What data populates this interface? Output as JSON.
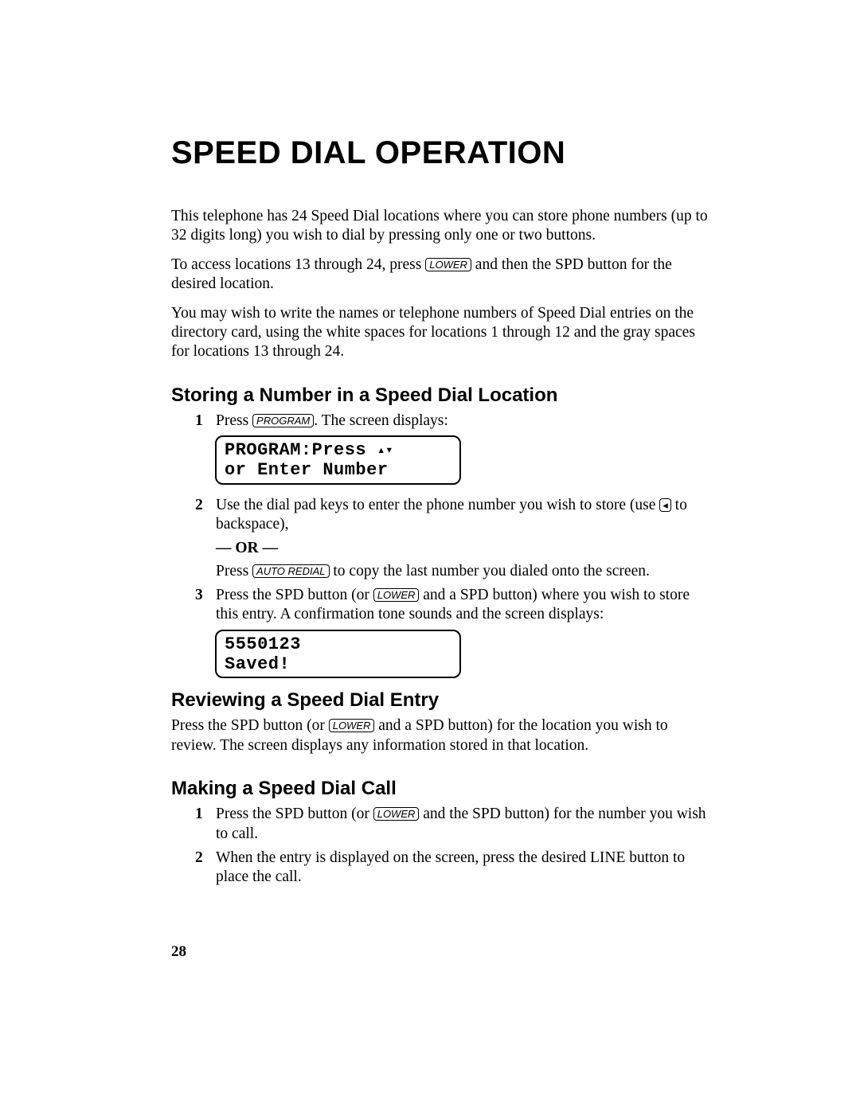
{
  "title": "SPEED DIAL OPERATION",
  "intro": {
    "p1": "This telephone has 24 Speed Dial locations where you can store phone numbers (up to 32 digits long) you wish to dial by pressing only one or two buttons.",
    "p2a": "To access locations 13 through 24, press ",
    "p2_key": "LOWER",
    "p2b": " and then the SPD button for the desired location.",
    "p3": "You may wish to write the names or telephone numbers of Speed Dial entries on the directory card, using the white spaces for locations 1 through 12 and the gray spaces for locations 13 through 24."
  },
  "storing": {
    "heading": "Storing a Number in a Speed Dial Location",
    "step1_num": "1",
    "step1a": "Press ",
    "step1_key": "PROGRAM",
    "step1b": ". The screen displays:",
    "lcd1_line1a": "PROGRAM:Press ",
    "lcd1_line1_arrows": "▴▾",
    "lcd1_line2": "or Enter Number",
    "step2_num": "2",
    "step2a": "Use the dial pad keys to enter the phone number you wish to store (use ",
    "step2_key": "◂",
    "step2b": " to backspace),",
    "or": "— OR —",
    "step2c_a": "Press ",
    "step2c_key": "AUTO REDIAL",
    "step2c_b": " to copy the last number you dialed onto the screen.",
    "step3_num": "3",
    "step3a": "Press the SPD button (or ",
    "step3_key": "LOWER",
    "step3b": " and a SPD button) where you wish to store this entry. A confirmation tone sounds and the screen displays:",
    "lcd2_line1": "5550123",
    "lcd2_line2": "Saved!"
  },
  "reviewing": {
    "heading": "Reviewing a Speed Dial Entry",
    "p_a": "Press the SPD button (or ",
    "p_key": "LOWER",
    "p_b": " and a SPD button) for the location you wish to review. The screen displays any information stored in that location."
  },
  "making": {
    "heading": "Making a Speed Dial Call",
    "step1_num": "1",
    "step1a": "Press the SPD button (or ",
    "step1_key": "LOWER",
    "step1b": " and the SPD button) for the number you wish to call.",
    "step2_num": "2",
    "step2": "When the entry is displayed on the screen, press the desired LINE button to place the call."
  },
  "page_number": "28"
}
